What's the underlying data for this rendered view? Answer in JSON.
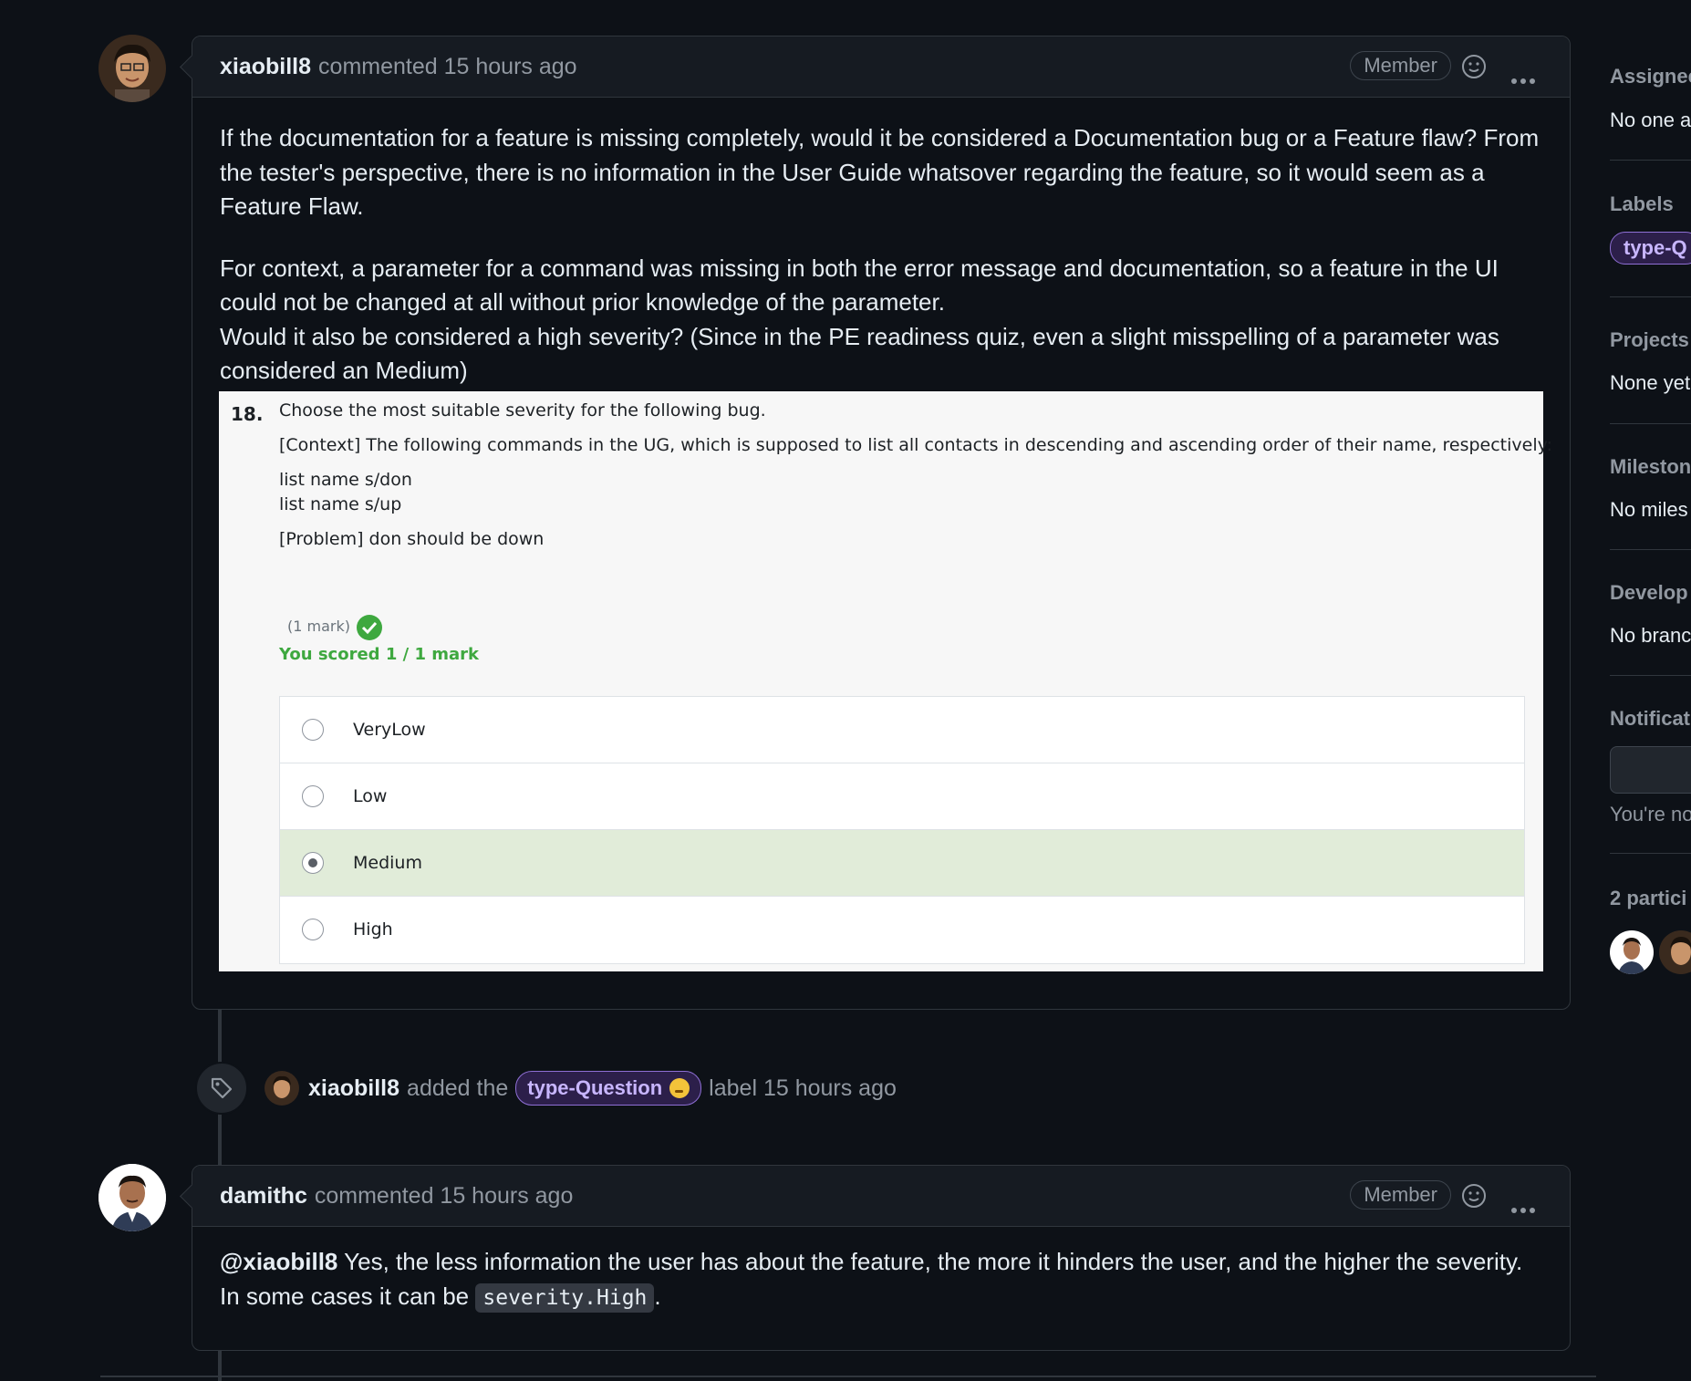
{
  "comment1": {
    "author": "xiaobill8",
    "meta": "commented 15 hours ago",
    "badge": "Member",
    "paragraphs": [
      "If the documentation for a feature is missing completely, would it be considered a Documentation bug or a Feature flaw? From the tester's perspective, there is no information in the User Guide whatsover regarding the feature, so it would seem as a Feature Flaw.",
      "For context, a parameter for a command was missing in both the error message and documentation, so a feature in the UI could not be changed at all without prior knowledge of the parameter.",
      "Would it also be considered a high severity? (Since in the PE readiness quiz, even a slight misspelling of a parameter was considered an Medium)"
    ]
  },
  "quiz": {
    "number": "18.",
    "question": "Choose the most suitable severity for the following bug.",
    "context": "[Context] The following commands in the UG, which is supposed to list all contacts in descending and ascending order of their name, respectively:",
    "cmd1": "list name s/don",
    "cmd2": "list name s/up",
    "problem": "[Problem] don should be down",
    "mark": "(1 mark)",
    "scored": "You scored 1 / 1 mark",
    "options": [
      {
        "label": "VeryLow",
        "selected": false
      },
      {
        "label": "Low",
        "selected": false
      },
      {
        "label": "Medium",
        "selected": true
      },
      {
        "label": "High",
        "selected": false
      }
    ]
  },
  "event": {
    "author": "xiaobill8",
    "action": "added the",
    "label": "type-Question",
    "suffix": "label 15 hours ago"
  },
  "comment2": {
    "author": "damithc",
    "meta": "commented 15 hours ago",
    "badge": "Member",
    "mention": "@xiaobill8",
    "text1": "Yes, the less information the user has about the feature, the more it hinders the user, and the higher the severity.",
    "text2": "In some cases it can be",
    "code": "severity.High",
    "end": "."
  },
  "sidebar": {
    "assignees_title": "Assignee",
    "assignees_value": "No one a",
    "labels_title": "Labels",
    "label_pill": "type-Q",
    "projects_title": "Projects",
    "projects_value": "None yet",
    "milestone_title": "Milestone",
    "milestone_value": "No miles",
    "development_title": "Develop",
    "development_value": "No branc",
    "notifications_title": "Notificat",
    "notifications_value": "You're no",
    "participants_title": "2 partici"
  },
  "colors": {
    "background": "#0d1117",
    "accent_label": "#c8b6ff",
    "quiz_correct": "#3ea83f",
    "selected_option": "#e1ecd9"
  }
}
